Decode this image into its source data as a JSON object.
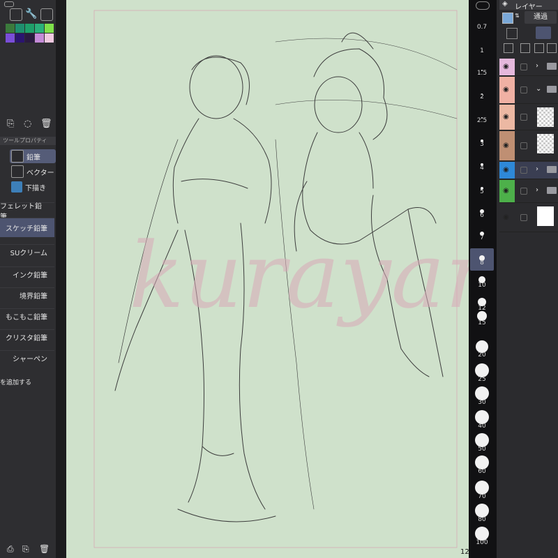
{
  "left_panel": {
    "section_title": "ツールプロパティ",
    "tools": [
      {
        "label": "鉛筆",
        "icon": "pencil-icon",
        "active": true
      },
      {
        "label": "ベクター",
        "icon": "vector-pen-icon",
        "active": false
      },
      {
        "label": "下描き",
        "icon": "sketch-icon",
        "active": false
      }
    ],
    "sub_tools": [
      {
        "label": "フェレット鉛筆",
        "active": false
      },
      {
        "label": "スケッチ鉛筆",
        "active": true
      },
      {
        "label": "SUクリーム",
        "active": false
      },
      {
        "label": "インク鉛筆",
        "active": false
      },
      {
        "label": "境界鉛筆",
        "active": false
      },
      {
        "label": "もこもこ鉛筆",
        "active": false
      },
      {
        "label": "クリスタ鉛筆",
        "active": false
      },
      {
        "label": "シャーペン",
        "active": false
      }
    ],
    "add_subtool_label": "を追加する",
    "palette_colors": [
      "#3b7a3c",
      "#1f8f6e",
      "#1fa06a",
      "#2ab07a",
      "#39c068",
      "#7fe04a",
      "#7a4ed8",
      "#5a2ba0",
      "#2b1470",
      "#2a1a40",
      "#c48ad8",
      "#f0c8e0"
    ],
    "icons": [
      "wrench-icon",
      "export-icon",
      "duplicate-icon",
      "clear-icon",
      "delete-icon"
    ]
  },
  "canvas": {
    "page_number": "12",
    "watermark": "kurayan"
  },
  "brush_sizes": [
    "0.7",
    "1",
    "1.5",
    "2",
    "2.5",
    "3",
    "4",
    "5",
    "6",
    "7",
    "8",
    "10",
    "12",
    "15",
    "20",
    "25",
    "30",
    "40",
    "50",
    "60",
    "70",
    "80",
    "100"
  ],
  "brush_size_selected": "8",
  "layer_panel": {
    "title": "レイヤー",
    "blend_mode": "通過",
    "layers": [
      {
        "color": "#e5b8dc",
        "type": "folder",
        "expanded": false
      },
      {
        "color": "#f0b1a4",
        "type": "folder",
        "expanded": true
      },
      {
        "color": "#ecb8a3",
        "type": "raster"
      },
      {
        "color": "#bf8f73",
        "type": "raster"
      },
      {
        "color": "#2e88d8",
        "type": "folder-active"
      },
      {
        "color": "#4db04a",
        "type": "folder"
      },
      {
        "color": "#2b2b2e",
        "type": "paper"
      }
    ]
  }
}
